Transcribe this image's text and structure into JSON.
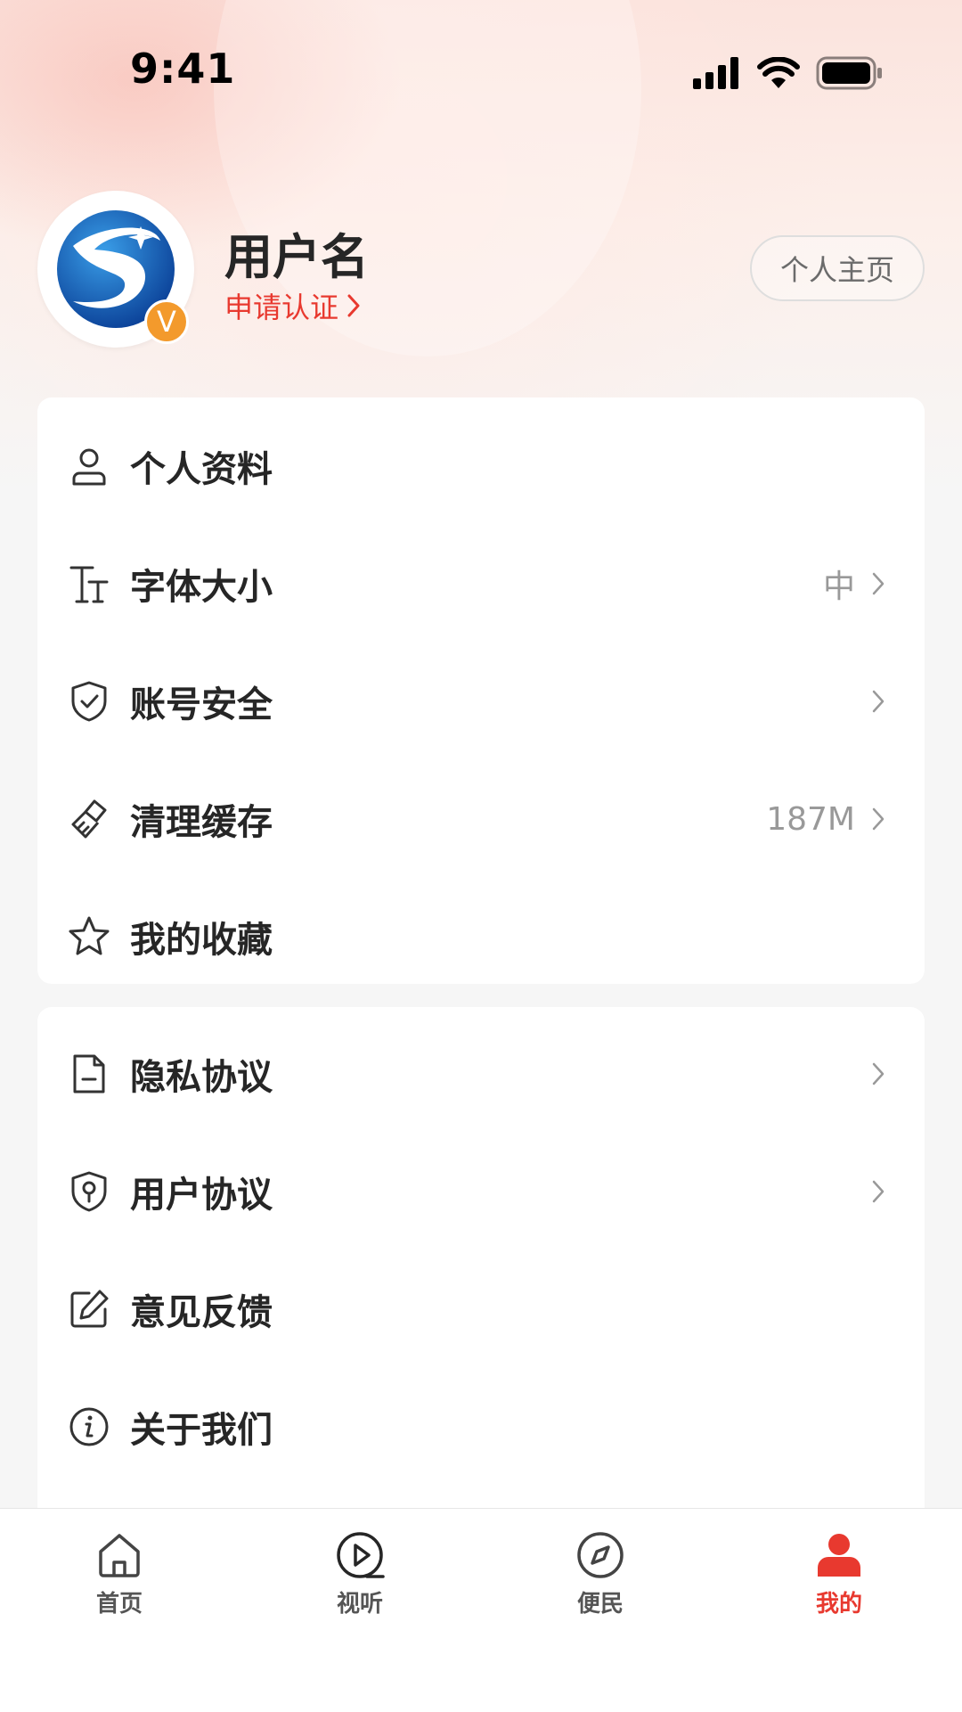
{
  "status_bar": {
    "time": "9:41"
  },
  "profile": {
    "username": "用户名",
    "verify_link": "申请认证",
    "badge": "V",
    "homepage_button": "个人主页"
  },
  "menu_group_1": [
    {
      "icon": "user-icon",
      "label": "个人资料",
      "value": "",
      "chevron": false
    },
    {
      "icon": "font-size-icon",
      "label": "字体大小",
      "value": "中",
      "chevron": true
    },
    {
      "icon": "shield-check-icon",
      "label": "账号安全",
      "value": "",
      "chevron": true
    },
    {
      "icon": "brush-icon",
      "label": "清理缓存",
      "value": "187M",
      "chevron": true
    },
    {
      "icon": "star-icon",
      "label": "我的收藏",
      "value": "",
      "chevron": false
    }
  ],
  "menu_group_2": [
    {
      "icon": "document-icon",
      "label": "隐私协议",
      "value": "",
      "chevron": true
    },
    {
      "icon": "shield-key-icon",
      "label": "用户协议",
      "value": "",
      "chevron": true
    },
    {
      "icon": "edit-icon",
      "label": "意见反馈",
      "value": "",
      "chevron": false
    },
    {
      "icon": "info-icon",
      "label": "关于我们",
      "value": "",
      "chevron": false
    }
  ],
  "tab_bar": {
    "active": "我的",
    "tabs": [
      {
        "icon": "home-icon",
        "label": "首页"
      },
      {
        "icon": "play-icon",
        "label": "视听"
      },
      {
        "icon": "compass-icon",
        "label": "便民"
      },
      {
        "icon": "person-icon",
        "label": "我的"
      }
    ]
  },
  "colors": {
    "accent": "#e8392f",
    "badge": "#f39a2c",
    "background": "#f6f6f6"
  }
}
